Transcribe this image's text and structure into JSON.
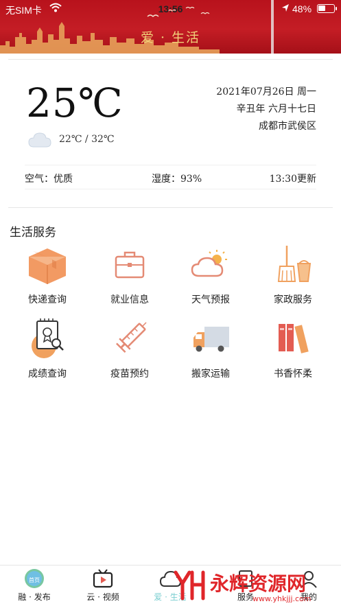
{
  "status_bar": {
    "carrier": "无SIM卡",
    "time": "13:56",
    "battery": "48%"
  },
  "header": {
    "title": "爱 · 生活"
  },
  "weather": {
    "temperature": "25℃",
    "range": "22℃ / 32℃",
    "date": "2021年07月26日 周一",
    "lunar": "辛丑年 六月十七日",
    "location": "成都市武侯区",
    "air_label": "空气：优质",
    "humidity_label": "湿度：93%",
    "updated": "13:30更新",
    "icon": "cloud-icon"
  },
  "services": {
    "title": "生活服务",
    "items": [
      {
        "label": "快递查询",
        "icon": "package-icon"
      },
      {
        "label": "就业信息",
        "icon": "briefcase-icon"
      },
      {
        "label": "天气预报",
        "icon": "weather-icon"
      },
      {
        "label": "家政服务",
        "icon": "broom-bucket-icon"
      },
      {
        "label": "成绩查询",
        "icon": "certificate-search-icon"
      },
      {
        "label": "疫苗预约",
        "icon": "syringe-icon"
      },
      {
        "label": "搬家运输",
        "icon": "truck-icon"
      },
      {
        "label": "书香怀柔",
        "icon": "books-icon"
      }
    ]
  },
  "tabbar": {
    "items": [
      {
        "label": "融 · 发布",
        "badge": "首页"
      },
      {
        "label": "云 · 视频"
      },
      {
        "label": "爱 · 生活"
      },
      {
        "label": "服务"
      },
      {
        "label": "我的"
      }
    ]
  },
  "watermark": {
    "logo_text": "永辉资源网",
    "url": "www.yhkjjj.com"
  },
  "colors": {
    "header_red": "#c41d25",
    "header_gold": "#f2d27a",
    "accent_orange": "#f0a15f",
    "tab_active": "#7ccfd1",
    "watermark_red": "#e0262a"
  }
}
